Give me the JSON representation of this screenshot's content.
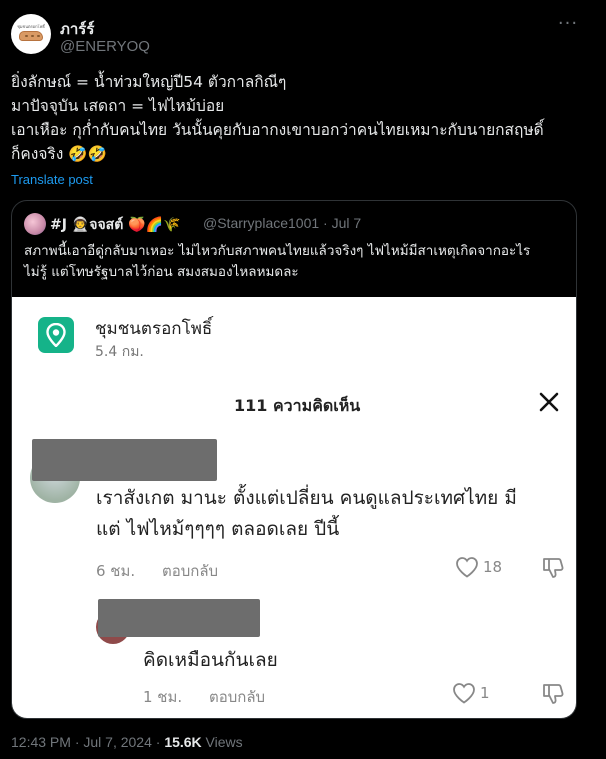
{
  "tweet": {
    "display_name": "ภาร์ร์",
    "handle": "@ENERYOQ",
    "avatar_caption": "ชุมชนตรอกโพธิ์",
    "more_icon": "more-dots-icon",
    "text_lines": [
      "ยิ่งลักษณ์ = น้ำท่วมใหญ่ปี54 ตัวกาลกิณีๆ",
      "มาปัจจุบัน เสดถา = ไฟไหม้บ่อย",
      "เอาเหือะ กุก่ำกับคนไทย วันนั้นคุยกับอากงเขาบอกว่าคนไทยเหมาะกับนายกสฤษดิ์",
      "ก็คงจริง 🤣🤣"
    ],
    "translate_label": "Translate post",
    "timestamp": "12:43 PM · Jul 7, 2024 · ",
    "views_count": "15.6K",
    "views_label": " Views"
  },
  "quote": {
    "display_name": "#J 👨‍🚀จจสต์ 🍑🌈🌾",
    "handle_date": "@Starryplace1001 · Jul 7",
    "text_lines": [
      "สภาพนี้เอาอีดู่กลับมาเหอะ ไม่ไหวกับสภาพคนไทยแล้วจริงๆ ไฟไหม้มีสาเหตุเกิดจากอะไร",
      "ไม่รู้ แต่โทษรัฐบาลไว้ก่อน สมงสมองไหลหมดละ"
    ]
  },
  "card": {
    "place_name": "ชุมชนตรอกโพธิ์",
    "place_distance": "5.4 กม.",
    "comments_title": "111 ความคิดเห็น",
    "comments": [
      {
        "text_lines": [
          "เราสังเกต มานะ ตั้งแต่เปลี่ยน คนดูแลประเทศไทย มี",
          "แต่ ไฟไหม้ๆๆๆๆ ตลอดเลย ปีนี้"
        ],
        "time": "6 ชม.",
        "reply_label": "ตอบกลับ",
        "likes": "18"
      },
      {
        "text_lines": [
          "คิดเหมือนกันเลย"
        ],
        "time": "1 ชม.",
        "reply_label": "ตอบกลับ",
        "likes": "1"
      }
    ]
  },
  "colors": {
    "background": "#000000",
    "link": "#1d9bf0",
    "muted": "#71767b",
    "map_green": "#15b389"
  }
}
